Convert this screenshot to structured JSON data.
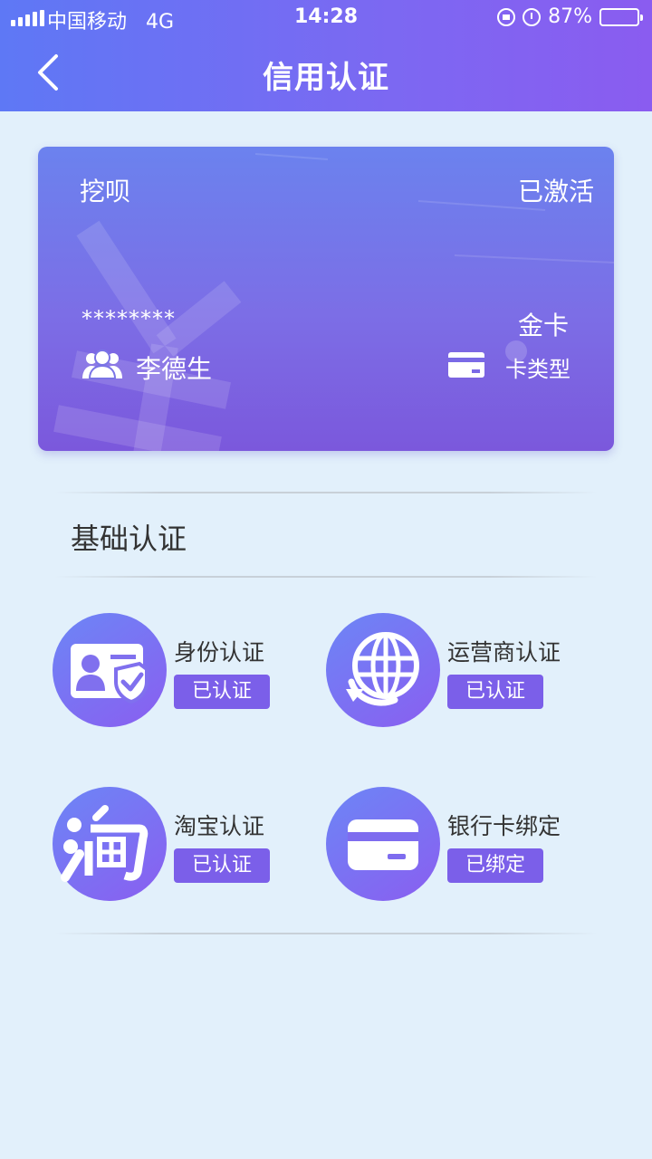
{
  "status_bar": {
    "carrier": "中国移动",
    "network": "4G",
    "time": "14:28",
    "battery_text": "87%",
    "battery_level": 0.87
  },
  "nav": {
    "title": "信用认证",
    "back_icon": "chevron-left-icon"
  },
  "card": {
    "brand": "挖呗",
    "status": "已激活",
    "masked_number": "********",
    "tier": "金卡",
    "holder_name": "李德生",
    "type_label": "卡类型",
    "user_icon": "users-icon",
    "card_icon": "credit-card-icon"
  },
  "section": {
    "title": "基础认证"
  },
  "verifications": [
    {
      "label": "身份认证",
      "badge": "已认证",
      "icon": "id-card-shield-icon"
    },
    {
      "label": "运营商认证",
      "badge": "已认证",
      "icon": "globe-refresh-icon"
    },
    {
      "label": "淘宝认证",
      "badge": "已认证",
      "icon": "taobao-icon"
    },
    {
      "label": "银行卡绑定",
      "badge": "已绑定",
      "icon": "bank-card-icon"
    }
  ],
  "colors": {
    "header_start": "#5e78f5",
    "header_end": "#8a5cf0",
    "accent": "#7b5fe9",
    "background": "#e2f0fb"
  }
}
